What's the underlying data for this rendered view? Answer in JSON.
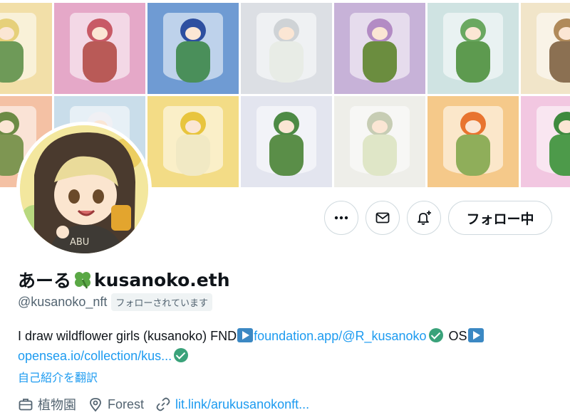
{
  "banner": {
    "tiles": [
      {
        "bg": "#f2dfa8",
        "hair": "#e6d07a",
        "dress": "#6e9a58"
      },
      {
        "bg": "#e5a8c8",
        "hair": "#c85a66",
        "dress": "#b95a57"
      },
      {
        "bg": "#6f9bd3",
        "hair": "#2d4fa0",
        "dress": "#4a8f5a"
      },
      {
        "bg": "#dcdfe4",
        "hair": "#cfd3d6",
        "dress": "#e8ece6"
      },
      {
        "bg": "#c7b2d8",
        "hair": "#b38bc4",
        "dress": "#6b8d3f"
      },
      {
        "bg": "#cfe3e2",
        "hair": "#6aa860",
        "dress": "#5d9a4f"
      },
      {
        "bg": "#f1e5c9",
        "hair": "#b08a5a",
        "dress": "#8b7052"
      },
      {
        "bg": "#f4c1a4",
        "hair": "#6c8b45",
        "dress": "#7e9652"
      },
      {
        "bg": "#c9ddea",
        "hair": "#f0f0f4",
        "dress": "#d9d2e8"
      },
      {
        "bg": "#f3dc86",
        "hair": "#e8c53e",
        "dress": "#f1e9c4"
      },
      {
        "bg": "#e3e5ef",
        "hair": "#4d8a45",
        "dress": "#5a8e48"
      },
      {
        "bg": "#eeeee9",
        "hair": "#c7cdb4",
        "dress": "#dfe6c7"
      },
      {
        "bg": "#f5c98a",
        "hair": "#e8742f",
        "dress": "#8fae5a"
      },
      {
        "bg": "#f2c7e1",
        "hair": "#3f8a3f",
        "dress": "#4d9a4a"
      }
    ]
  },
  "actions": {
    "more_icon": "more-horizontal-icon",
    "message_icon": "envelope-icon",
    "notify_icon": "bell-plus-icon",
    "follow_label": "フォロー中"
  },
  "profile": {
    "name_prefix": "あーる",
    "name_emoji": "four-leaf-clover-icon",
    "name_suffix": "kusanoko.eth",
    "handle": "@kusanoko_nft",
    "follows_you": "フォローされています"
  },
  "bio": {
    "text1": "I draw wildflower girls (kusanoko) FND",
    "link1": "foundation.app/@R_kusanoko",
    "text2": " OS",
    "link2": "opensea.io/collection/kus..."
  },
  "translate_label": "自己紹介を翻訳",
  "meta": {
    "category_icon": "briefcase-icon",
    "category": "植物園",
    "location_icon": "location-pin-icon",
    "location": "Forest",
    "link_icon": "link-icon",
    "link": "lit.link/arukusanokonft..."
  },
  "colors": {
    "link": "#1d9bf0",
    "muted": "#536471",
    "border": "#cfd9de",
    "verified": "#3aa27a",
    "play_badge": "#3b88c3"
  }
}
